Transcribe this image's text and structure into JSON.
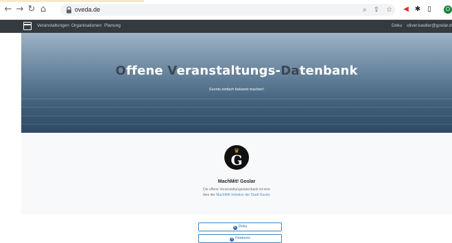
{
  "browser": {
    "url": "oveda.de",
    "profile_initial": "O"
  },
  "navbar": {
    "links": [
      "Veranstaltungen",
      "Organisationen",
      "Planung"
    ],
    "right_links": [
      "Doku",
      "oliver.kastler@goslar.de"
    ]
  },
  "hero": {
    "title_parts": [
      {
        "text": "O",
        "style": "dim"
      },
      {
        "text": "ffene ",
        "style": "light"
      },
      {
        "text": "V",
        "style": "dim"
      },
      {
        "text": "eranstaltungs-",
        "style": "light"
      },
      {
        "text": "Da",
        "style": "dim"
      },
      {
        "text": "tenbank",
        "style": "light"
      }
    ],
    "subtitle": "Events einfach bekannt machen!"
  },
  "organization": {
    "logo_letter": "G",
    "name": "MachMit! Goslar",
    "description_prefix": "Die offene Veranstaltungsdatenbank ist eine Idee der ",
    "description_link": "MachMit!-Initiative der Stadt Goslar",
    "description_suffix": "."
  },
  "buttons": {
    "doku": "Doku",
    "features": "Features"
  },
  "colors": {
    "navbar": "#343a40",
    "accent": "#2f6fad",
    "profile": "#188038"
  }
}
